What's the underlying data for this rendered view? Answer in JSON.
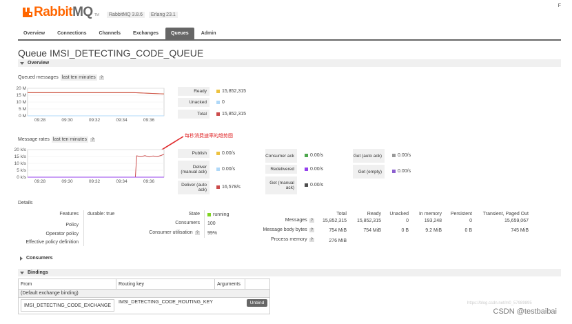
{
  "app": {
    "logo_rabbit": "Rabbit",
    "logo_mq": "MQ",
    "logo_tm": "TM",
    "rabbitmq_version": "RabbitMQ 3.8.6",
    "erlang_version": "Erlang 23.1",
    "corner_mark": "F"
  },
  "nav": {
    "tabs": [
      {
        "label": "Overview",
        "active": false
      },
      {
        "label": "Connections",
        "active": false
      },
      {
        "label": "Channels",
        "active": false
      },
      {
        "label": "Exchanges",
        "active": false
      },
      {
        "label": "Queues",
        "active": true
      },
      {
        "label": "Admin",
        "active": false
      }
    ]
  },
  "page": {
    "title_prefix": "Queue",
    "queue_name": "IMSI_DETECTING_CODE_QUEUE"
  },
  "overview": {
    "section_label": "Overview",
    "queued_label": "Queued messages",
    "queued_range": "last ten minutes",
    "rates_label": "Message rates",
    "rates_range": "last ten minutes",
    "help": "?",
    "queued_stats": [
      {
        "label": "Ready",
        "value": "15,852,315",
        "color": "#edc240"
      },
      {
        "label": "Unacked",
        "value": "0",
        "color": "#afd8f8"
      },
      {
        "label": "Total",
        "value": "15,852,315",
        "color": "#cb4b4b"
      }
    ],
    "rates_stats": [
      {
        "label": "Publish",
        "value": "0.00/s",
        "color": "#edc240"
      },
      {
        "label": "Deliver (manual ack)",
        "value": "0.00/s",
        "color": "#afd8f8"
      },
      {
        "label": "Deliver (auto ack)",
        "value": "16,578/s",
        "color": "#cb4b4b"
      },
      {
        "label": "Consumer ack",
        "value": "0.00/s",
        "color": "#4da74d"
      },
      {
        "label": "Redelivered",
        "value": "0.00/s",
        "color": "#9440ed"
      },
      {
        "label": "Get (manual ack)",
        "value": "0.00/s",
        "color": "#4d4d4d"
      },
      {
        "label": "Get (auto ack)",
        "value": "0.00/s",
        "color": "#999999"
      },
      {
        "label": "Get (empty)",
        "value": "0.00/s",
        "color": "#8c5fcf"
      }
    ],
    "annotation": "每秒消费速率的趋势图"
  },
  "chart_data": [
    {
      "type": "line",
      "title": "Queued messages",
      "x": [
        "09:28",
        "09:30",
        "09:32",
        "09:34",
        "09:36"
      ],
      "yticks": [
        "20 M",
        "15 M",
        "10 M",
        "5 M",
        "0 M"
      ],
      "ylim": [
        0,
        20000000
      ],
      "series": [
        {
          "name": "Ready",
          "color": "#edc240",
          "points": [
            [
              0,
              16800000
            ],
            [
              0.78,
              16800000
            ],
            [
              1,
              15852315
            ]
          ]
        },
        {
          "name": "Total",
          "color": "#cb4b4b",
          "points": [
            [
              0,
              16800000
            ],
            [
              0.78,
              16800000
            ],
            [
              1,
              15852315
            ]
          ]
        },
        {
          "name": "Unacked",
          "color": "#afd8f8",
          "points": [
            [
              0,
              0
            ],
            [
              1,
              0
            ]
          ]
        }
      ]
    },
    {
      "type": "line",
      "title": "Message rates",
      "x": [
        "09:28",
        "09:30",
        "09:32",
        "09:34",
        "09:36"
      ],
      "yticks": [
        "20 k/s",
        "15 k/s",
        "10 k/s",
        "5 k/s",
        "0 k/s"
      ],
      "ylim": [
        0,
        20000
      ],
      "series": [
        {
          "name": "Deliver (auto ack)",
          "color": "#cb4b4b",
          "points": [
            [
              0,
              0
            ],
            [
              0.79,
              0
            ],
            [
              0.8,
              15500
            ],
            [
              0.83,
              14800
            ],
            [
              0.86,
              15600
            ],
            [
              0.89,
              14700
            ],
            [
              0.92,
              15400
            ],
            [
              0.95,
              14900
            ],
            [
              0.98,
              15800
            ],
            [
              1,
              16578
            ]
          ]
        },
        {
          "name": "Publish",
          "color": "#9440ed",
          "points": [
            [
              0,
              0
            ],
            [
              1,
              0
            ]
          ]
        }
      ]
    }
  ],
  "details": {
    "section_label": "Details",
    "features_label": "Features",
    "features_value": "durable: true",
    "policy_label": "Policy",
    "operator_policy_label": "Operator policy",
    "effective_policy_label": "Effective policy definition",
    "state_label": "State",
    "state_value": "running",
    "state_color": "#7ed321",
    "consumers_label": "Consumers",
    "consumers_value": "100",
    "utilisation_label": "Consumer utilisation",
    "utilisation_value": "99%",
    "columns": [
      "Total",
      "Ready",
      "Unacked",
      "In memory",
      "Persistent",
      "Transient, Paged Out"
    ],
    "rows": [
      {
        "label": "Messages",
        "values": [
          "15,852,315",
          "15,852,315",
          "0",
          "193,248",
          "0",
          "15,659,067"
        ]
      },
      {
        "label": "Message body bytes",
        "values": [
          "754 MiB",
          "754 MiB",
          "0 B",
          "9.2 MiB",
          "0 B",
          "745 MiB"
        ]
      },
      {
        "label": "Process memory",
        "values": [
          "276 MiB",
          "",
          "",
          "",
          "",
          ""
        ]
      }
    ]
  },
  "consumers": {
    "section_label": "Consumers"
  },
  "bindings": {
    "section_label": "Bindings",
    "headers": [
      "From",
      "Routing key",
      "Arguments"
    ],
    "default_binding": "(Default exchange binding)",
    "exchange": "IMSI_DETECTING_CODE_EXCHANGE",
    "routing_key": "IMSI_DETECTING_CODE_ROUTING_KEY",
    "unbind_label": "Unbind"
  },
  "watermark": {
    "text": "CSDN @testbaibai",
    "faint": "https://blog.csdn.net/m0_57989895"
  }
}
